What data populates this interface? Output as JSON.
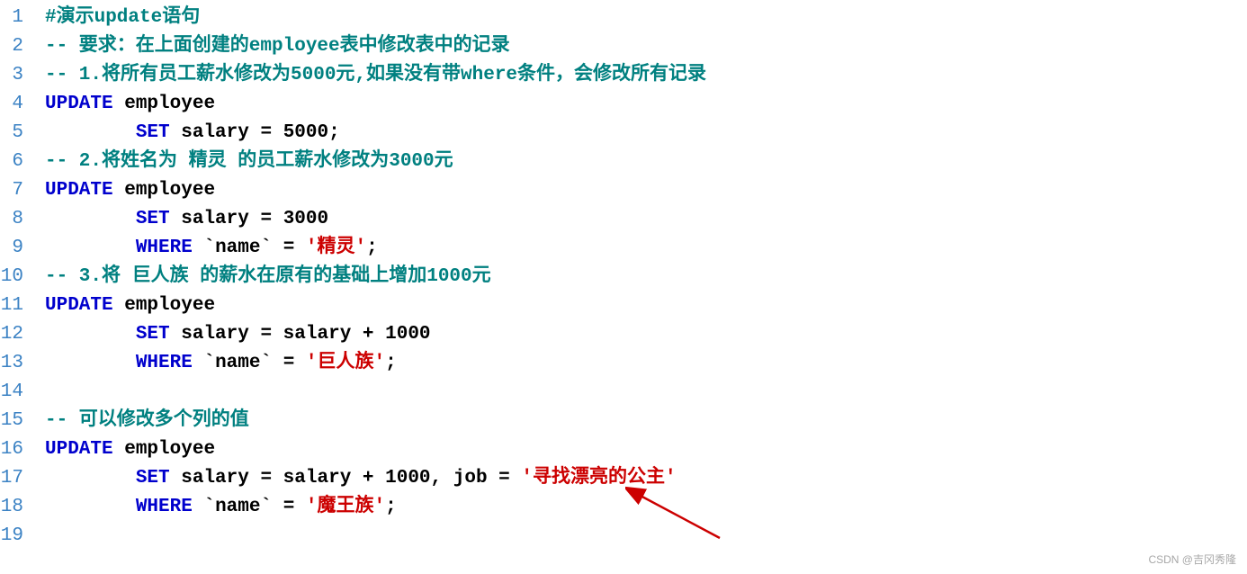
{
  "watermark": "CSDN @吉冈秀隆",
  "lines": [
    {
      "n": "1",
      "tokens": [
        {
          "cls": "comment-hash",
          "t": "#演示update语句"
        }
      ]
    },
    {
      "n": "2",
      "tokens": [
        {
          "cls": "comment-dash",
          "t": "-- 要求：在上面创建的employee表中修改表中的记录"
        }
      ]
    },
    {
      "n": "3",
      "tokens": [
        {
          "cls": "comment-dash",
          "t": "-- 1.将所有员工薪水修改为5000元,如果没有带where条件，会修改所有记录"
        }
      ]
    },
    {
      "n": "4",
      "tokens": [
        {
          "cls": "keyword",
          "t": "UPDATE"
        },
        {
          "cls": "ident",
          "t": " employee"
        }
      ]
    },
    {
      "n": "5",
      "tokens": [
        {
          "cls": "ident",
          "t": "        "
        },
        {
          "cls": "keyword",
          "t": "SET"
        },
        {
          "cls": "ident",
          "t": " salary "
        },
        {
          "cls": "op",
          "t": "="
        },
        {
          "cls": "ident",
          "t": " "
        },
        {
          "cls": "num",
          "t": "5000"
        },
        {
          "cls": "op",
          "t": ";"
        }
      ]
    },
    {
      "n": "6",
      "tokens": [
        {
          "cls": "comment-dash",
          "t": "-- 2.将姓名为 精灵 的员工薪水修改为3000元"
        }
      ]
    },
    {
      "n": "7",
      "tokens": [
        {
          "cls": "keyword",
          "t": "UPDATE"
        },
        {
          "cls": "ident",
          "t": " employee"
        }
      ]
    },
    {
      "n": "8",
      "tokens": [
        {
          "cls": "ident",
          "t": "        "
        },
        {
          "cls": "keyword",
          "t": "SET"
        },
        {
          "cls": "ident",
          "t": " salary "
        },
        {
          "cls": "op",
          "t": "="
        },
        {
          "cls": "ident",
          "t": " "
        },
        {
          "cls": "num",
          "t": "3000"
        }
      ]
    },
    {
      "n": "9",
      "tokens": [
        {
          "cls": "ident",
          "t": "        "
        },
        {
          "cls": "keyword",
          "t": "WHERE"
        },
        {
          "cls": "ident",
          "t": " "
        },
        {
          "cls": "op",
          "t": "`"
        },
        {
          "cls": "ident",
          "t": "name"
        },
        {
          "cls": "op",
          "t": "`"
        },
        {
          "cls": "ident",
          "t": " "
        },
        {
          "cls": "op",
          "t": "="
        },
        {
          "cls": "ident",
          "t": " "
        },
        {
          "cls": "str",
          "t": "'精灵'"
        },
        {
          "cls": "op",
          "t": ";"
        }
      ]
    },
    {
      "n": "10",
      "tokens": [
        {
          "cls": "comment-dash",
          "t": "-- 3.将 巨人族 的薪水在原有的基础上增加1000元"
        }
      ]
    },
    {
      "n": "11",
      "tokens": [
        {
          "cls": "keyword",
          "t": "UPDATE"
        },
        {
          "cls": "ident",
          "t": " employee"
        }
      ]
    },
    {
      "n": "12",
      "tokens": [
        {
          "cls": "ident",
          "t": "        "
        },
        {
          "cls": "keyword",
          "t": "SET"
        },
        {
          "cls": "ident",
          "t": " salary "
        },
        {
          "cls": "op",
          "t": "="
        },
        {
          "cls": "ident",
          "t": " salary "
        },
        {
          "cls": "op",
          "t": "+"
        },
        {
          "cls": "ident",
          "t": " "
        },
        {
          "cls": "num",
          "t": "1000"
        }
      ]
    },
    {
      "n": "13",
      "tokens": [
        {
          "cls": "ident",
          "t": "        "
        },
        {
          "cls": "keyword",
          "t": "WHERE"
        },
        {
          "cls": "ident",
          "t": " "
        },
        {
          "cls": "op",
          "t": "`"
        },
        {
          "cls": "ident",
          "t": "name"
        },
        {
          "cls": "op",
          "t": "`"
        },
        {
          "cls": "ident",
          "t": " "
        },
        {
          "cls": "op",
          "t": "="
        },
        {
          "cls": "ident",
          "t": " "
        },
        {
          "cls": "str",
          "t": "'巨人族'"
        },
        {
          "cls": "op",
          "t": ";"
        }
      ]
    },
    {
      "n": "14",
      "tokens": []
    },
    {
      "n": "15",
      "tokens": [
        {
          "cls": "comment-dash",
          "t": "-- 可以修改多个列的值"
        }
      ]
    },
    {
      "n": "16",
      "tokens": [
        {
          "cls": "keyword",
          "t": "UPDATE"
        },
        {
          "cls": "ident",
          "t": " employee"
        }
      ]
    },
    {
      "n": "17",
      "tokens": [
        {
          "cls": "ident",
          "t": "        "
        },
        {
          "cls": "keyword",
          "t": "SET"
        },
        {
          "cls": "ident",
          "t": " salary "
        },
        {
          "cls": "op",
          "t": "="
        },
        {
          "cls": "ident",
          "t": " salary "
        },
        {
          "cls": "op",
          "t": "+"
        },
        {
          "cls": "ident",
          "t": " "
        },
        {
          "cls": "num",
          "t": "1000"
        },
        {
          "cls": "op",
          "t": ","
        },
        {
          "cls": "ident",
          "t": " job "
        },
        {
          "cls": "op",
          "t": "="
        },
        {
          "cls": "ident",
          "t": " "
        },
        {
          "cls": "str",
          "t": "'寻找漂亮的公主'"
        }
      ]
    },
    {
      "n": "18",
      "tokens": [
        {
          "cls": "ident",
          "t": "        "
        },
        {
          "cls": "keyword",
          "t": "WHERE"
        },
        {
          "cls": "ident",
          "t": " "
        },
        {
          "cls": "op",
          "t": "`"
        },
        {
          "cls": "ident",
          "t": "name"
        },
        {
          "cls": "op",
          "t": "`"
        },
        {
          "cls": "ident",
          "t": " "
        },
        {
          "cls": "op",
          "t": "="
        },
        {
          "cls": "ident",
          "t": " "
        },
        {
          "cls": "str",
          "t": "'魔王族'"
        },
        {
          "cls": "op",
          "t": ";"
        }
      ]
    },
    {
      "n": "19",
      "tokens": []
    }
  ]
}
